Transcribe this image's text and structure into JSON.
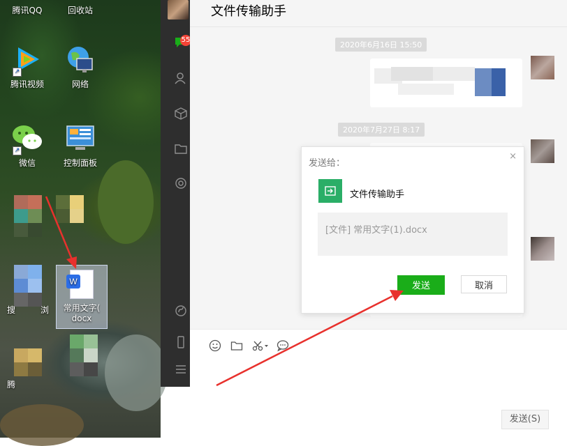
{
  "desktop": {
    "icons": [
      {
        "label": "腾讯QQ"
      },
      {
        "label": "回收站"
      },
      {
        "label": "腾讯视频"
      },
      {
        "label": "网络"
      },
      {
        "label": "微信"
      },
      {
        "label": "控制面板"
      }
    ],
    "file": {
      "label_line1": "常用文字(",
      "label_line2": "docx"
    },
    "partial_labels": {
      "search": "搜",
      "search_tail": "浏",
      "tencent": "腾"
    }
  },
  "sidebar": {
    "unread_count": "55"
  },
  "chat": {
    "title": "文件传输助手",
    "timestamps": [
      "2020年6月16日 15:50",
      "2020年7月27日 8:17"
    ],
    "send_button": "发送(S)"
  },
  "dialog": {
    "title": "发送给：",
    "close": "×",
    "recipient": "文件传输助手",
    "file_text": "[文件] 常用文字(1).docx",
    "send": "发送",
    "cancel": "取消"
  },
  "colors": {
    "accent_green": "#1aad19",
    "annotation_red": "#e8312d"
  }
}
